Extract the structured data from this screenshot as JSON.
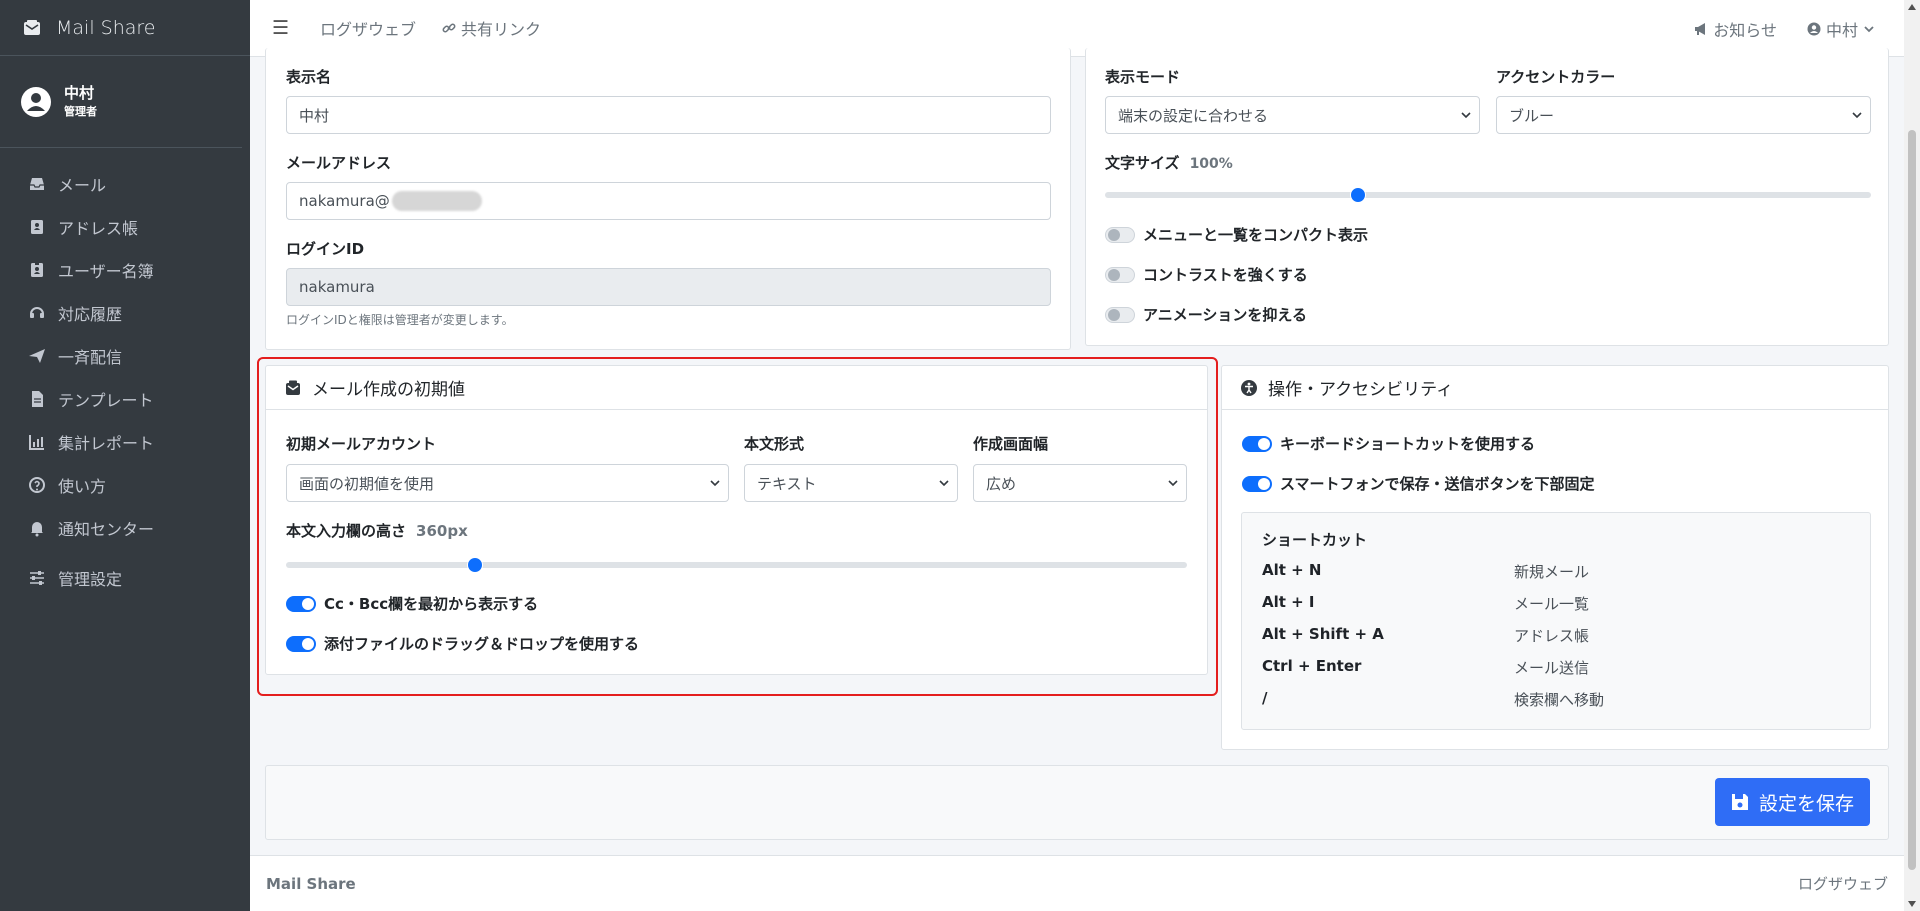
{
  "brand": "Mail Share",
  "user": {
    "name": "中村",
    "role": "管理者"
  },
  "sidebar": {
    "items": [
      {
        "label": "メール",
        "icon": "inbox-icon"
      },
      {
        "label": "アドレス帳",
        "icon": "address-book-icon"
      },
      {
        "label": "ユーザー名簿",
        "icon": "id-badge-icon"
      },
      {
        "label": "対応履歴",
        "icon": "headset-icon"
      },
      {
        "label": "一斉配信",
        "icon": "paper-plane-icon"
      },
      {
        "label": "テンプレート",
        "icon": "file-icon"
      },
      {
        "label": "集計レポート",
        "icon": "chart-icon"
      },
      {
        "label": "使い方",
        "icon": "question-icon"
      },
      {
        "label": "通知センター",
        "icon": "bell-icon"
      },
      {
        "label": "管理設定",
        "icon": "sliders-icon"
      }
    ]
  },
  "header": {
    "link1": "ログザウェブ",
    "link2": "共有リンク",
    "notice": "お知らせ",
    "user": "中村"
  },
  "profile": {
    "display_name_label": "表示名",
    "display_name": "中村",
    "email_label": "メールアドレス",
    "email_prefix": "nakamura@",
    "login_label": "ログインID",
    "login_id": "nakamura",
    "help": "ログインIDと権限は管理者が変更します。"
  },
  "display": {
    "mode_label": "表示モード",
    "mode_value": "端末の設定に合わせる",
    "accent_label": "アクセントカラー",
    "accent_value": "ブルー",
    "font_label": "文字サイズ",
    "font_value": "100%",
    "font_level": 0.33,
    "compact": "メニューと一覧をコンパクト表示",
    "contrast": "コントラストを強くする",
    "animation": "アニメーションを抑える"
  },
  "compose": {
    "title": "メール作成の初期値",
    "account_label": "初期メールアカウント",
    "account_value": "画面の初期値を使用",
    "format_label": "本文形式",
    "format_value": "テキスト",
    "width_label": "作成画面幅",
    "width_value": "広め",
    "height_label": "本文入力欄の高さ",
    "height_value": "360px",
    "height_level": 0.21,
    "ccbcc": "Cc・Bcc欄を最初から表示する",
    "dragdrop": "添付ファイルのドラッグ＆ドロップを使用する"
  },
  "access": {
    "title": "操作・アクセシビリティ",
    "shortcuts_toggle": "キーボードショートカットを使用する",
    "mobile_toggle": "スマートフォンで保存・送信ボタンを下部固定",
    "shortcut_title": "ショートカット",
    "shortcuts": [
      {
        "key": "Alt + N",
        "desc": "新規メール"
      },
      {
        "key": "Alt + I",
        "desc": "メール一覧"
      },
      {
        "key": "Alt + Shift + A",
        "desc": "アドレス帳"
      },
      {
        "key": "Ctrl + Enter",
        "desc": "メール送信"
      },
      {
        "key": "/",
        "desc": "検索欄へ移動"
      }
    ]
  },
  "save_label": "設定を保存",
  "footer": {
    "left": "Mail Share",
    "right": "ログザウェブ"
  },
  "colors": {
    "sidebar": "#343a40",
    "accent": "#0d6efd",
    "highlight": "#e41e1e"
  }
}
